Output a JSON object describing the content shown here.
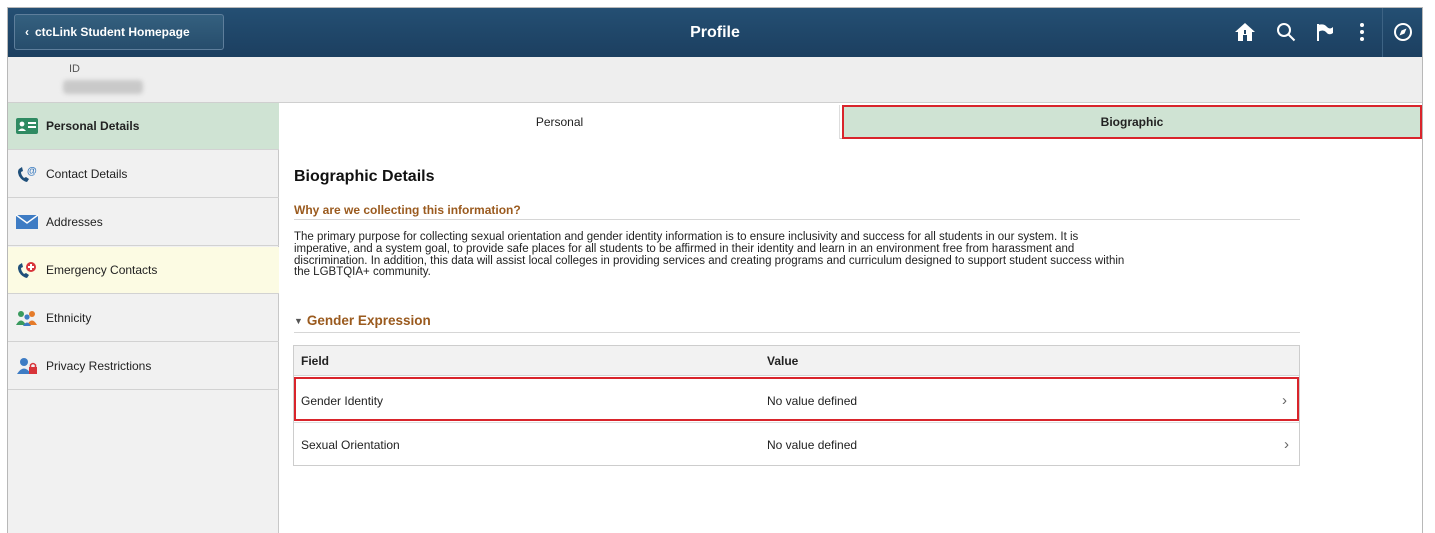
{
  "header": {
    "back_label": "ctcLink Student Homepage",
    "title": "Profile",
    "icons": [
      "home-icon",
      "search-icon",
      "flag-icon",
      "more-vertical-icon",
      "compass-icon"
    ]
  },
  "idbar": {
    "label": "ID"
  },
  "nav": {
    "items": [
      {
        "label": "Personal Details",
        "icon": "id-card-icon"
      },
      {
        "label": "Contact Details",
        "icon": "phone-at-icon"
      },
      {
        "label": "Addresses",
        "icon": "envelope-icon"
      },
      {
        "label": "Emergency Contacts",
        "icon": "emergency-phone-icon"
      },
      {
        "label": "Ethnicity",
        "icon": "people-icon"
      },
      {
        "label": "Privacy Restrictions",
        "icon": "person-lock-icon"
      }
    ]
  },
  "tabs": [
    {
      "label": "Personal"
    },
    {
      "label": "Biographic"
    }
  ],
  "content": {
    "heading": "Biographic Details",
    "why_heading": "Why are we collecting this information?",
    "paragraph_lines": [
      "The primary purpose for collecting sexual orientation and gender identity information is to ensure inclusivity and success for all students in our system. It is",
      "imperative, and a system goal, to provide safe places for all students to be affirmed in their identity and learn in an environment free from harassment and",
      "discrimination. In addition, this data will assist local colleges in providing services and creating programs and curriculum designed to support student success within",
      "the LGBTQIA+ community."
    ],
    "section_heading": "Gender Expression",
    "grid": {
      "columns": [
        "Field",
        "Value"
      ],
      "rows": [
        {
          "field": "Gender Identity",
          "value": "No value defined"
        },
        {
          "field": "Sexual Orientation",
          "value": "No value defined"
        }
      ]
    }
  },
  "colors": {
    "header_bg": "#1f4566",
    "active_green": "#cfe3d3",
    "highlight_red": "#d9242b",
    "section_brown": "#9a5a1e"
  }
}
